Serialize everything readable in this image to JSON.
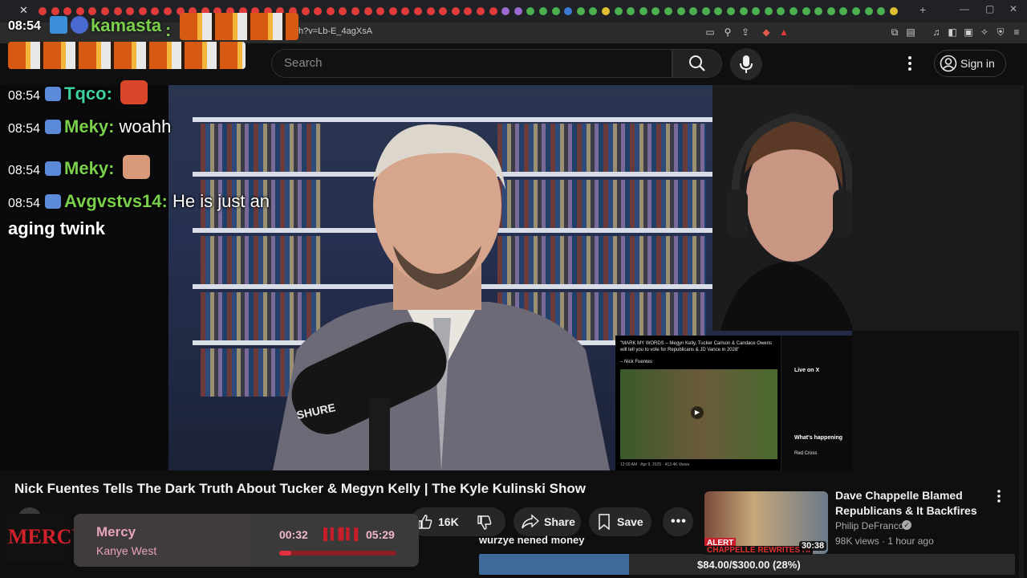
{
  "browser": {
    "url": "h?v=Lb-E_4agXsA",
    "tab_colors": [
      "#e03a3a",
      "#e03a3a",
      "#e03a3a",
      "#e03a3a",
      "#e03a3a",
      "#e03a3a",
      "#e03a3a",
      "#e03a3a",
      "#e03a3a",
      "#e03a3a",
      "#e03a3a",
      "#e03a3a",
      "#e03a3a",
      "#e03a3a",
      "#e03a3a",
      "#e03a3a",
      "#e03a3a",
      "#e03a3a",
      "#e03a3a",
      "#e03a3a",
      "#e03a3a",
      "#e03a3a",
      "#e03a3a",
      "#e03a3a",
      "#e03a3a",
      "#e03a3a",
      "#e03a3a",
      "#e03a3a",
      "#e03a3a",
      "#e03a3a",
      "#e03a3a",
      "#e03a3a",
      "#e03a3a",
      "#e03a3a",
      "#e03a3a",
      "#e03a3a",
      "#e03a3a",
      "#9a6acd",
      "#9a6acd",
      "#4caf50",
      "#4caf50",
      "#4caf50",
      "#3a7bd5",
      "#4caf50",
      "#4caf50",
      "#e0c030",
      "#4caf50",
      "#4caf50",
      "#4caf50",
      "#4caf50",
      "#4caf50",
      "#4caf50",
      "#4caf50",
      "#4caf50",
      "#4caf50",
      "#4caf50",
      "#4caf50",
      "#4caf50",
      "#4caf50",
      "#4caf50",
      "#4caf50",
      "#4caf50",
      "#4caf50",
      "#4caf50",
      "#4caf50",
      "#4caf50",
      "#4caf50",
      "#4caf50",
      "#e0c030"
    ]
  },
  "header": {
    "search_placeholder": "Search",
    "signin_label": "Sign in"
  },
  "chat": {
    "top_time": "08:54",
    "top_user": "kamasta",
    "lines": [
      {
        "time": "08:54",
        "user": "Tqco",
        "user_color": "#3fd0a0",
        "text": ""
      },
      {
        "time": "08:54",
        "user": "Meky",
        "user_color": "#7ad04a",
        "text": "woahh"
      },
      {
        "time": "08:54",
        "user": "Meky",
        "user_color": "#7ad04a",
        "text": ""
      },
      {
        "time": "08:54",
        "user": "Avgvstvs14",
        "user_color": "#7ad04a",
        "text": "He is just an"
      }
    ],
    "wrap_text": "aging twink"
  },
  "video": {
    "title": "Nick Fuentes Tells The Dark Truth About Tucker & Megyn Kelly | The Kyle Kulinski Show",
    "likes": "16K",
    "share_label": "Share",
    "save_label": "Save",
    "mic_brand": "SHURE"
  },
  "overlay_tweet": {
    "quote": "\"MARK MY WORDS – Megyn Kelly, Tucker Carlson & Candace Owens will tell you to vote for Republicans & JD Vance in 2028\"",
    "author": "– Nick Fuentes",
    "timestamp": "12:00 AM · Apr 9, 2025 · 413.4K Views",
    "sidebar_heading": "Live on X",
    "happening_heading": "What's happening",
    "red_cross": "Red Cross"
  },
  "music": {
    "badge": "MERCY",
    "song": "Mercy",
    "artist": "Kanye West",
    "elapsed": "00:32",
    "total": "05:29",
    "progress": 0.1
  },
  "donation": {
    "message": "wurzye nened money",
    "goal_text": "$84.00/$300.00 (28%)",
    "goal_fraction": 0.28
  },
  "recommended": {
    "title_line1": "Dave Chappelle Blamed",
    "title_line2": "Republicans & It Backfires",
    "channel": "Philip DeFranco",
    "meta": "98K views · 1 hour ago",
    "duration": "30:38",
    "thumb_text": "CHAPPELLE REWRITES HI",
    "thumb_alert": "ALERT"
  }
}
